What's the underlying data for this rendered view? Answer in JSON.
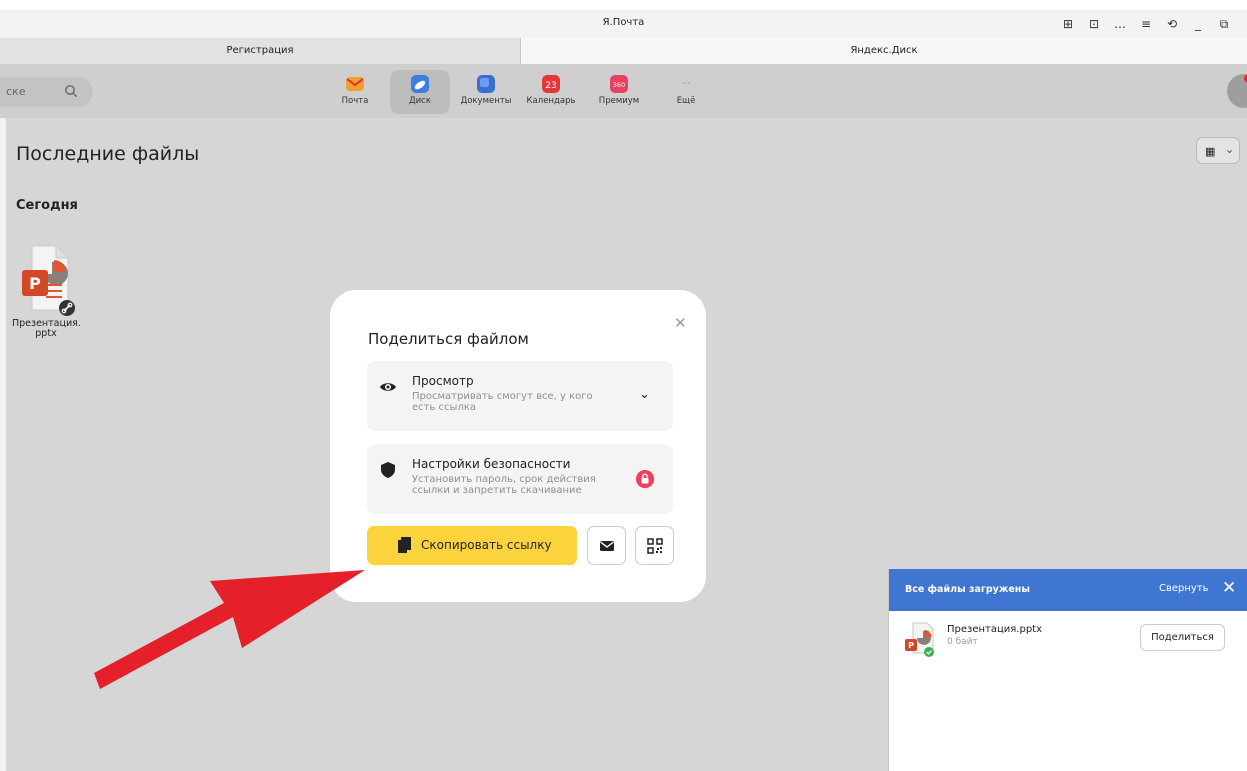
{
  "window": {
    "title": "Я.Почта",
    "controls": [
      "⊞",
      "⊡",
      "…",
      "≡",
      "⟲",
      "_",
      "⧉"
    ]
  },
  "tabs": [
    {
      "label": "Регистрация"
    },
    {
      "label": "Яндекс.Диск"
    }
  ],
  "header": {
    "search_placeholder": "ске",
    "services": [
      {
        "label": "Почта",
        "icon": "mail-icon",
        "color": "#f0a030"
      },
      {
        "label": "Диск",
        "icon": "disk-icon",
        "color": "#3b7de0"
      },
      {
        "label": "Документы",
        "icon": "docs-icon",
        "color": "#3a6fd1"
      },
      {
        "label": "Календарь",
        "icon": "calendar-icon",
        "color": "#e23838",
        "badge": "23"
      },
      {
        "label": "Премиум",
        "icon": "premium-icon",
        "color": "#e8405e",
        "badge": "360"
      },
      {
        "label": "Ещё",
        "icon": "more-icon",
        "color": "#cfcfcf",
        "badge": "···"
      }
    ]
  },
  "page": {
    "title": "Последние файлы",
    "section": "Сегодня",
    "file": {
      "name": "Презентация.\npptx"
    }
  },
  "modal": {
    "heading": "Поделиться файлом",
    "access": {
      "title": "Просмотр",
      "subtitle": "Просматривать смогут все, у кого есть ссылка"
    },
    "security": {
      "title": "Настройки безопасности",
      "subtitle": "Установить пароль, срок действия ссылки и запретить скачивание"
    },
    "copy_label": "Скопировать ссылку"
  },
  "upload": {
    "title": "Все файлы загружены",
    "collapse_label": "Свернуть",
    "file_name": "Презентация.pptx",
    "file_size": "0 байт",
    "share_label": "Поделиться"
  },
  "colors": {
    "accent_blue": "#3f76d1",
    "copy_yellow": "#fbd33d",
    "arrow_red": "#e5202a",
    "lock_red": "#f1405a"
  }
}
